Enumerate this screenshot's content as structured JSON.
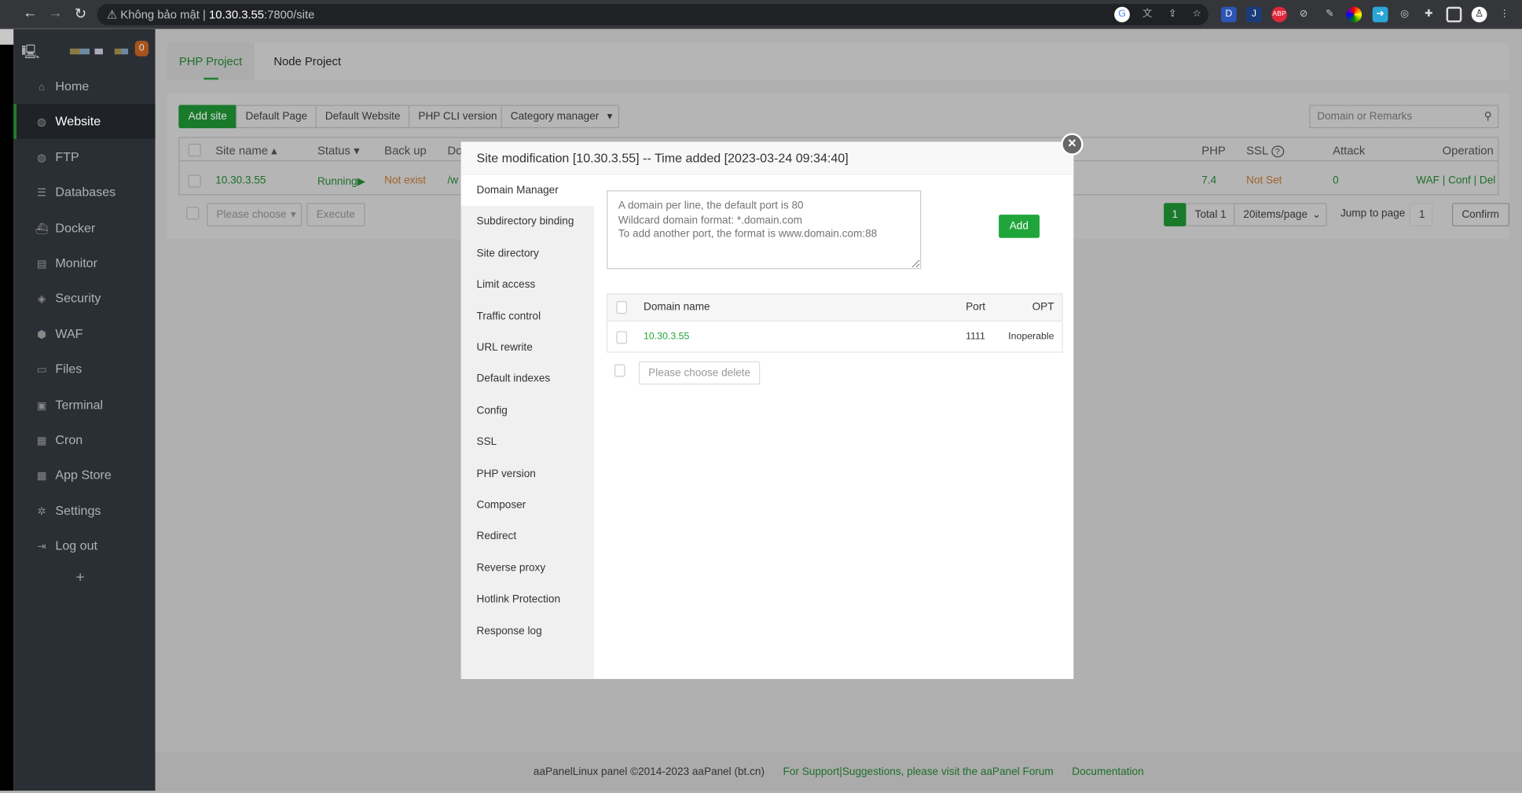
{
  "browser": {
    "security": "Không bảo mật",
    "url_host": "10.30.3.55",
    "url_rest": ":7800/site"
  },
  "sidebar": {
    "badge": "0",
    "items": [
      {
        "label": "Home",
        "icon": "home-icon"
      },
      {
        "label": "Website",
        "icon": "globe-icon"
      },
      {
        "label": "FTP",
        "icon": "ftp-icon"
      },
      {
        "label": "Databases",
        "icon": "database-icon"
      },
      {
        "label": "Docker",
        "icon": "docker-icon"
      },
      {
        "label": "Monitor",
        "icon": "monitor-icon"
      },
      {
        "label": "Security",
        "icon": "shield-icon"
      },
      {
        "label": "WAF",
        "icon": "waf-icon"
      },
      {
        "label": "Files",
        "icon": "folder-icon"
      },
      {
        "label": "Terminal",
        "icon": "terminal-icon"
      },
      {
        "label": "Cron",
        "icon": "calendar-icon"
      },
      {
        "label": "App Store",
        "icon": "grid-icon"
      },
      {
        "label": "Settings",
        "icon": "gear-icon"
      },
      {
        "label": "Log out",
        "icon": "logout-icon"
      }
    ],
    "add": "+"
  },
  "tabs": [
    "PHP Project",
    "Node Project"
  ],
  "toolbar": {
    "add_site": "Add site",
    "default_page": "Default Page",
    "default_website": "Default Website",
    "php_cli": "PHP CLI version",
    "category": "Category manager",
    "search_placeholder": "Domain or Remarks"
  },
  "table": {
    "headers": {
      "site_name": "Site name",
      "status": "Status",
      "backup": "Back up",
      "doc": "Do",
      "php": "PHP",
      "ssl": "SSL",
      "attack": "Attack",
      "operation": "Operation"
    },
    "row": {
      "site": "10.30.3.55",
      "status": "Running",
      "backup": "Not exist",
      "path": "/w",
      "php": "7.4",
      "ssl": "Not Set",
      "attack": "0",
      "ops": [
        "WAF",
        "Conf",
        "Del"
      ]
    }
  },
  "bulk": {
    "select": "Please choose",
    "execute": "Execute"
  },
  "pagination": {
    "current": "1",
    "total": "Total 1",
    "per_page": "20items/page",
    "jump_label": "Jump to page",
    "jump_value": "1",
    "confirm": "Confirm"
  },
  "modal": {
    "title": "Site modification [10.30.3.55] -- Time added [2023-03-24 09:34:40]",
    "nav": [
      "Domain Manager",
      "Subdirectory binding",
      "Site directory",
      "Limit access",
      "Traffic control",
      "URL rewrite",
      "Default indexes",
      "Config",
      "SSL",
      "PHP version",
      "Composer",
      "Redirect",
      "Reverse proxy",
      "Hotlink Protection",
      "Response log"
    ],
    "placeholder": "A domain per line, the default port is 80\nWildcard domain format: *.domain.com\nTo add another port, the format is www.domain.com:88",
    "add": "Add",
    "headers": {
      "domain": "Domain name",
      "port": "Port",
      "opt": "OPT"
    },
    "row": {
      "domain": "10.30.3.55",
      "port": "1111",
      "opt": "Inoperable"
    },
    "delete": "Please choose delete"
  },
  "footer": {
    "copyright": "aaPanelLinux panel ©2014-2023 aaPanel (bt.cn)",
    "support": "For Support|Suggestions, please visit the aaPanel Forum",
    "docs": "Documentation"
  }
}
